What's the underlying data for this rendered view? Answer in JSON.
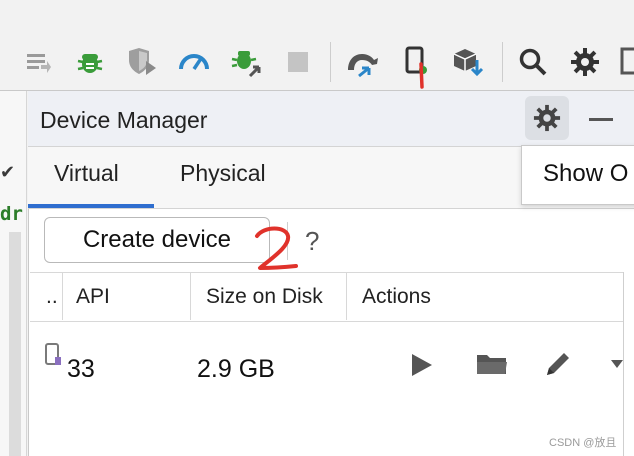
{
  "toolbar": {
    "icons": [
      "format-icon",
      "bug-icon",
      "shield-run-icon",
      "profiler-gauge-icon",
      "attach-debugger-icon",
      "stop-icon",
      "sync-gradle-icon",
      "device-manager-icon",
      "sdk-manager-icon",
      "search-icon",
      "settings-icon"
    ]
  },
  "left_gutter": {
    "check": "✔",
    "code_fragment": "dr"
  },
  "panel": {
    "title": "Device Manager",
    "tabs": [
      {
        "label": "Virtual",
        "selected": true
      },
      {
        "label": "Physical",
        "selected": false
      }
    ],
    "popup_item": "Show O",
    "create_button": "Create device",
    "help": "?"
  },
  "table": {
    "columns": [
      "..",
      "API",
      "Size on Disk",
      "Actions"
    ],
    "rows": [
      {
        "api": "33",
        "size": "2.9 GB"
      }
    ]
  },
  "annotations": {
    "mark_1": "1",
    "mark_2": "2"
  },
  "watermark": "CSDN @放且",
  "colors": {
    "accent": "#2f6ecf",
    "annotation_red": "#e0322b",
    "icon_green": "#3a9c3a",
    "icon_blue": "#2b86c9"
  }
}
